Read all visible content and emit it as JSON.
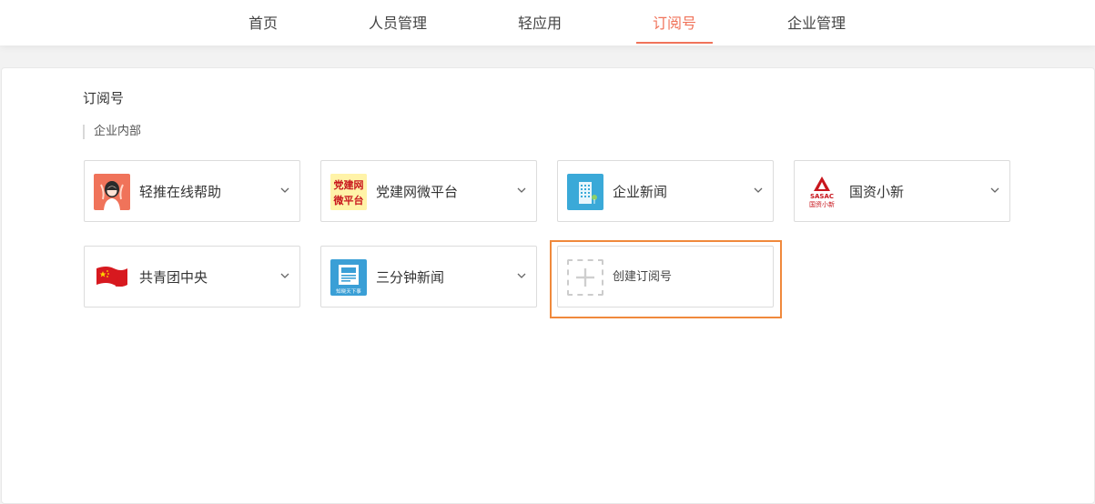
{
  "nav": {
    "items": [
      {
        "label": "首页"
      },
      {
        "label": "人员管理"
      },
      {
        "label": "轻应用"
      },
      {
        "label": "订阅号"
      },
      {
        "label": "企业管理"
      }
    ],
    "active_index": 3,
    "accent_color": "#f0735a"
  },
  "main": {
    "section_title": "订阅号",
    "subsection_label": "企业内部",
    "subscriptions": [
      {
        "name": "轻推在线帮助",
        "icon": "help-avatar-icon"
      },
      {
        "name": "党建网微平台",
        "icon": "party-building-logo",
        "logo_text_top": "党建网",
        "logo_text_bottom": "微平台"
      },
      {
        "name": "企业新闻",
        "icon": "building-icon"
      },
      {
        "name": "国资小新",
        "icon": "sasac-logo",
        "logo_text_top": "SASAC",
        "logo_text_bottom": "国资小新"
      },
      {
        "name": "共青团中央",
        "icon": "youth-league-flag-icon"
      },
      {
        "name": "三分钟新闻",
        "icon": "newspaper-icon",
        "logo_text_bottom": "知晓天下事"
      }
    ],
    "create": {
      "label": "创建订阅号",
      "icon": "plus-icon",
      "highlight_color": "#f0893c"
    }
  }
}
